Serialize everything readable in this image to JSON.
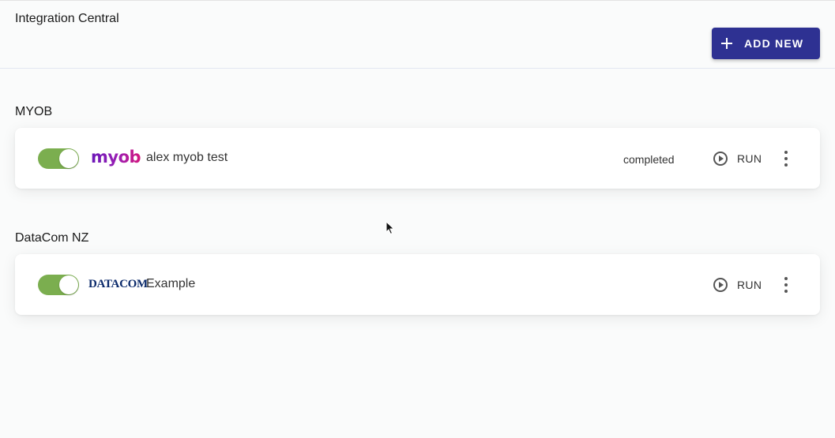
{
  "header": {
    "title": "Integration Central",
    "add_new_label": "ADD NEW",
    "add_new_icon": "plus-icon"
  },
  "sections": [
    {
      "title": "MYOB",
      "item": {
        "enabled": true,
        "logo_text": "myob",
        "name": "alex myob test",
        "status": "completed",
        "run_label": "RUN"
      }
    },
    {
      "title": "DataCom NZ",
      "item": {
        "enabled": true,
        "logo_text": "DATACOM",
        "name": "Example",
        "status": "",
        "run_label": "RUN"
      }
    }
  ],
  "colors": {
    "accent": "#2e3192",
    "toggle_on": "#7bae4f",
    "myob_brand": "#9b1fb4",
    "datacom_brand": "#0b2a6b"
  }
}
